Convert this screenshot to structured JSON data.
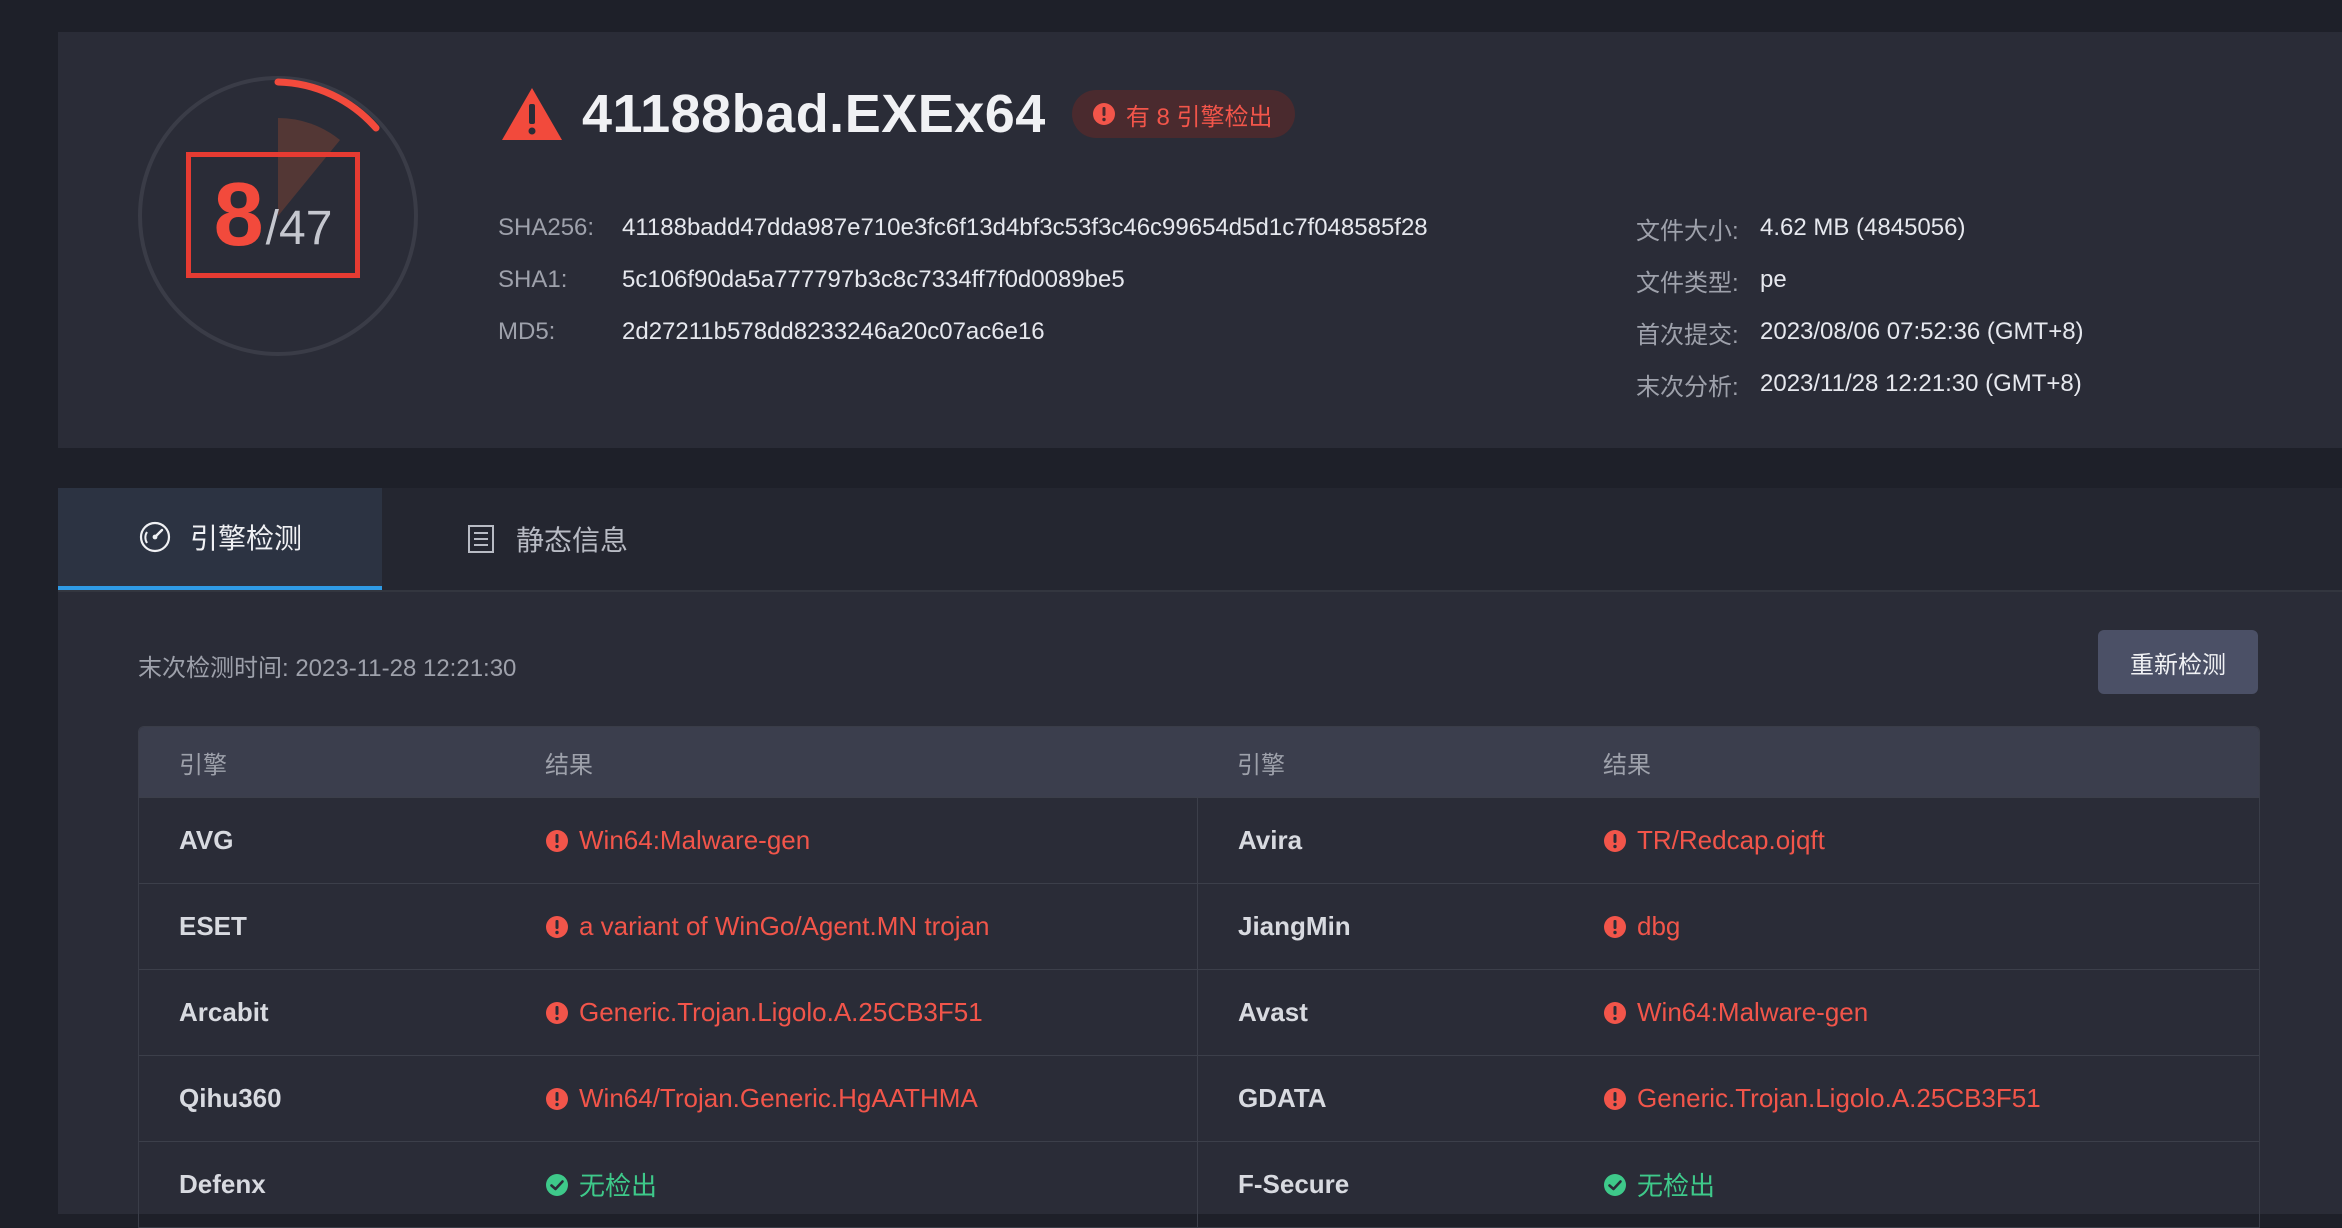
{
  "colors": {
    "danger": "#f2554a",
    "safe": "#3ec98a",
    "accent": "#2f9be6"
  },
  "score": {
    "detected": "8",
    "total": "/47"
  },
  "file": {
    "name": "41188bad.EXEx64",
    "badge": "有 8 引擎检出"
  },
  "hashes": [
    {
      "label": "SHA256:",
      "value": "41188badd47dda987e710e3fc6f13d4bf3c53f3c46c99654d5d1c7f048585f28"
    },
    {
      "label": "SHA1:",
      "value": "5c106f90da5a777797b3c8c7334ff7f0d0089be5"
    },
    {
      "label": "MD5:",
      "value": "2d27211b578dd8233246a20c07ac6e16"
    }
  ],
  "meta": [
    {
      "label": "文件大小:",
      "value": "4.62 MB (4845056)"
    },
    {
      "label": "文件类型:",
      "value": "pe"
    },
    {
      "label": "首次提交:",
      "value": "2023/08/06 07:52:36 (GMT+8)"
    },
    {
      "label": "末次分析:",
      "value": "2023/11/28 12:21:30 (GMT+8)"
    }
  ],
  "tabs": [
    {
      "label": "引擎检测",
      "icon": "gauge-icon"
    },
    {
      "label": "静态信息",
      "icon": "document-icon"
    }
  ],
  "scan": {
    "last_scan": "末次检测时间: 2023-11-28 12:21:30",
    "rescan_label": "重新检测"
  },
  "table": {
    "headers": [
      "引擎",
      "结果",
      "引擎",
      "结果"
    ],
    "rows": [
      {
        "e1": "AVG",
        "r1": "Win64:Malware-gen",
        "s1": "bad",
        "e2": "Avira",
        "r2": "TR/Redcap.ojqft",
        "s2": "bad"
      },
      {
        "e1": "ESET",
        "r1": "a variant of WinGo/Agent.MN trojan",
        "s1": "bad",
        "e2": "JiangMin",
        "r2": "dbg",
        "s2": "bad"
      },
      {
        "e1": "Arcabit",
        "r1": "Generic.Trojan.Ligolo.A.25CB3F51",
        "s1": "bad",
        "e2": "Avast",
        "r2": "Win64:Malware-gen",
        "s2": "bad"
      },
      {
        "e1": "Qihu360",
        "r1": "Win64/Trojan.Generic.HgAATHMA",
        "s1": "bad",
        "e2": "GDATA",
        "r2": "Generic.Trojan.Ligolo.A.25CB3F51",
        "s2": "bad"
      },
      {
        "e1": "Defenx",
        "r1": "无检出",
        "s1": "ok",
        "e2": "F-Secure",
        "r2": "无检出",
        "s2": "ok"
      }
    ]
  }
}
